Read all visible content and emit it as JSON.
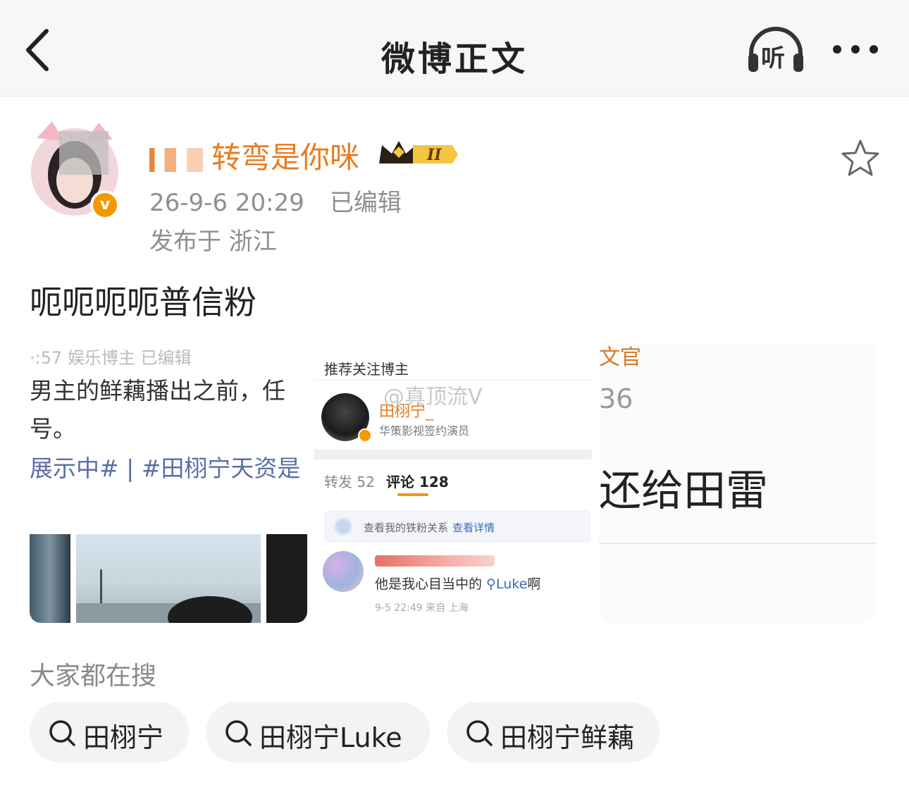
{
  "header": {
    "title": "微博正文",
    "listen_label": "听",
    "icons": {
      "back": "chevron-left-icon",
      "listen": "headphones-icon",
      "more": "more-dots-icon"
    }
  },
  "author": {
    "name": "转弯是你咪",
    "badge_level": "II",
    "time": "26-9-6 20:29",
    "edited": "已编辑",
    "location": "发布于 浙江",
    "verified_mark": "v"
  },
  "post": {
    "text": "呃呃呃呃普信粉"
  },
  "images": {
    "image1": {
      "top_text": "·:57 娱乐博主 已编辑",
      "line1": "男主的鲜藕播出之前，任",
      "line2": "号。",
      "line3": "展示中#  | #田栩宁天资是"
    },
    "image2": {
      "header": "推荐关注博主",
      "name": "田栩宁_",
      "desc": "华策影视签约演员",
      "tab_repost": "转发 52",
      "tab_comment": "评论 128",
      "fans_text": "查看我的铁粉关系",
      "fans_link": "查看详情",
      "comment_text": "他是我心目当中的 ",
      "comment_link": "Luke",
      "comment_suffix": "啊",
      "comment_time": "9-5 22:49 来自 上海",
      "watermark": "@真顶流V"
    },
    "image3": {
      "top_text": "文官",
      "number": "36",
      "big_text": "还给田雷"
    }
  },
  "search": {
    "heading": "大家都在搜",
    "chips": [
      "田栩宁",
      "田栩宁Luke",
      "田栩宁鲜藕"
    ]
  },
  "colors": {
    "accent": "#ea7b1f",
    "verified": "#f39800",
    "link": "#3a6ac0",
    "meta": "#8f8f8f"
  }
}
